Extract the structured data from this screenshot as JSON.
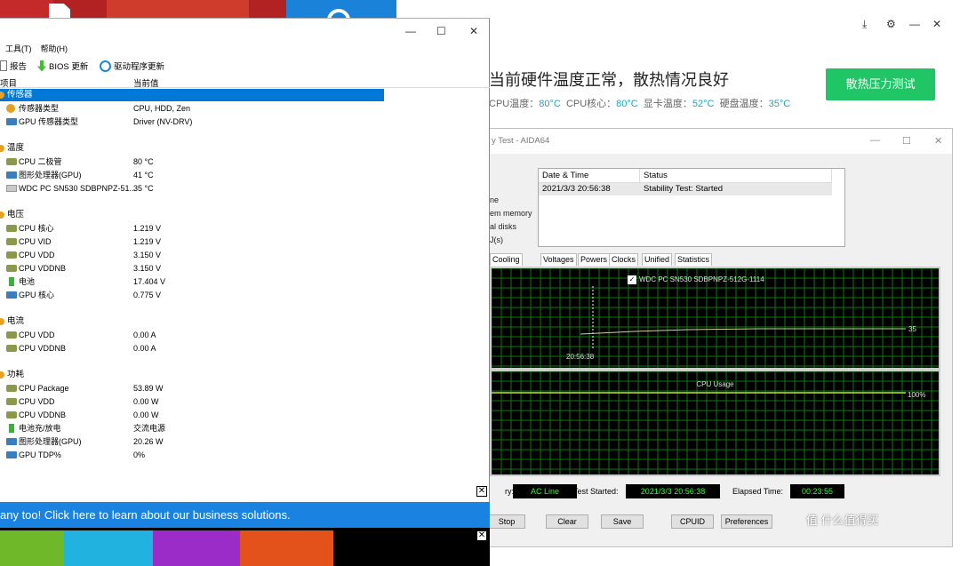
{
  "hwinfo": {
    "menu": [
      "工具(T)",
      "帮助(H)"
    ],
    "toolbar": {
      "report": "报告",
      "bios": "BIOS 更新",
      "driver": "驱动程序更新"
    },
    "columns": {
      "item": "项目",
      "value": "当前值"
    },
    "rows": [
      {
        "type": "cat",
        "name": "传感器",
        "value": "",
        "selected": true
      },
      {
        "type": "item",
        "icon": "sensor",
        "name": "传感器类型",
        "value": "CPU, HDD, Zen"
      },
      {
        "type": "item",
        "icon": "gpu",
        "name": "GPU 传感器类型",
        "value": "Driver  (NV-DRV)"
      },
      {
        "type": "gap"
      },
      {
        "type": "cat",
        "name": "温度",
        "value": ""
      },
      {
        "type": "item",
        "icon": "chip",
        "name": "CPU 二极管",
        "value": "80 °C"
      },
      {
        "type": "item",
        "icon": "gpu",
        "name": "图形处理器(GPU)",
        "value": "41 °C"
      },
      {
        "type": "item",
        "icon": "disk",
        "name": "WDC PC SN530 SDBPNPZ-51...",
        "value": "35 °C"
      },
      {
        "type": "gap"
      },
      {
        "type": "cat",
        "name": "电压",
        "value": ""
      },
      {
        "type": "item",
        "icon": "chip",
        "name": "CPU 核心",
        "value": "1.219 V"
      },
      {
        "type": "item",
        "icon": "chip",
        "name": "CPU VID",
        "value": "1.219 V"
      },
      {
        "type": "item",
        "icon": "chip",
        "name": "CPU VDD",
        "value": "3.150 V"
      },
      {
        "type": "item",
        "icon": "chip",
        "name": "CPU VDDNB",
        "value": "3.150 V"
      },
      {
        "type": "item",
        "icon": "battery",
        "name": "电池",
        "value": "17.404 V"
      },
      {
        "type": "item",
        "icon": "gpu",
        "name": "GPU 核心",
        "value": "0.775 V"
      },
      {
        "type": "gap"
      },
      {
        "type": "cat",
        "name": "电流",
        "value": ""
      },
      {
        "type": "item",
        "icon": "chip",
        "name": "CPU VDD",
        "value": "0.00 A"
      },
      {
        "type": "item",
        "icon": "chip",
        "name": "CPU VDDNB",
        "value": "0.00 A"
      },
      {
        "type": "gap"
      },
      {
        "type": "cat",
        "name": "功耗",
        "value": ""
      },
      {
        "type": "item",
        "icon": "chip",
        "name": "CPU Package",
        "value": "53.89 W"
      },
      {
        "type": "item",
        "icon": "chip",
        "name": "CPU VDD",
        "value": "0.00 W"
      },
      {
        "type": "item",
        "icon": "chip",
        "name": "CPU VDDNB",
        "value": "0.00 W"
      },
      {
        "type": "item",
        "icon": "battery",
        "name": "电池充/放电",
        "value": "交流电源"
      },
      {
        "type": "item",
        "icon": "gpu",
        "name": "图形处理器(GPU)",
        "value": "20.26 W"
      },
      {
        "type": "item",
        "icon": "gpu",
        "name": "GPU TDP%",
        "value": "0%"
      }
    ],
    "banner": "any too! Click here to learn about our business solutions."
  },
  "pcmanager": {
    "headline": "当前硬件温度正常，散热情况良好",
    "temps": [
      {
        "label": "CPU温度：",
        "value": "80°C"
      },
      {
        "label": "CPU核心：",
        "value": "80°C"
      },
      {
        "label": "显卡温度：",
        "value": "52°C"
      },
      {
        "label": "硬盘温度：",
        "value": "35°C"
      }
    ],
    "stress_button": "散热压力测试",
    "accent": "#20c565"
  },
  "aida": {
    "title": "y Test - AIDA64",
    "side_labels": [
      "ne",
      "em memory",
      "al disks",
      "J(s)"
    ],
    "log_headers": {
      "time": "Date & Time",
      "status": "Status"
    },
    "log_rows": [
      {
        "time": "2021/3/3 20:56:38",
        "status": "Stability Test: Started"
      }
    ],
    "tabs": [
      "Cooling Fans",
      "Voltages",
      "Powers",
      "Clocks",
      "Unified",
      "Statistics"
    ],
    "graph1": {
      "legend": "WDC PC SN530 SDBPNPZ-512G-1114",
      "time_label": "20:56:38",
      "value_label": "35"
    },
    "graph2": {
      "title": "CPU Usage",
      "value_label": "100%"
    },
    "footer": {
      "battery_label": "ry:",
      "battery_value": "AC Line",
      "started_label": "Test Started:",
      "started_value": "2021/3/3 20:56:38",
      "elapsed_label": "Elapsed Time:",
      "elapsed_value": "00:23:55"
    },
    "buttons": [
      "Stop",
      "Clear",
      "Save",
      "CPUID",
      "Preferences"
    ]
  },
  "watermark": "值 什么值得买"
}
